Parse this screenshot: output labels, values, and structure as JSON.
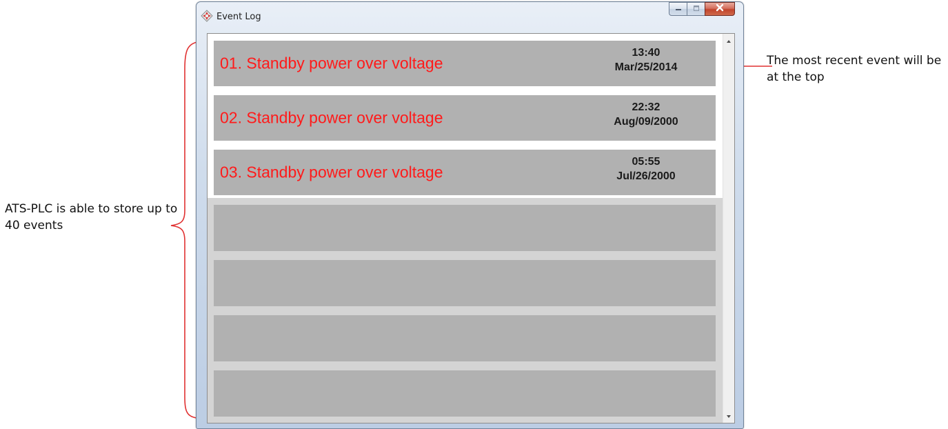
{
  "window": {
    "title": "Event Log",
    "controls": {
      "minimize_icon": "minimize-icon",
      "maximize_icon": "maximize-icon",
      "close_icon": "close-icon"
    }
  },
  "events": [
    {
      "text": "01. Standby power over voltage",
      "time": "13:40",
      "date": "Mar/25/2014"
    },
    {
      "text": "02. Standby power over voltage",
      "time": "22:32",
      "date": "Aug/09/2000"
    },
    {
      "text": "03. Standby power over voltage",
      "time": "05:55",
      "date": "Jul/26/2000"
    },
    {
      "text": "",
      "time": "",
      "date": ""
    },
    {
      "text": "",
      "time": "",
      "date": ""
    },
    {
      "text": "",
      "time": "",
      "date": ""
    },
    {
      "text": "",
      "time": "",
      "date": ""
    }
  ],
  "annotations": {
    "left": "ATS-PLC is able to store up to 40 events",
    "right": "The most recent event will be at the top"
  },
  "colors": {
    "event_text": "#ff1a1a",
    "row_bg": "#b1b1b1",
    "annotation_stroke": "#e03030"
  }
}
